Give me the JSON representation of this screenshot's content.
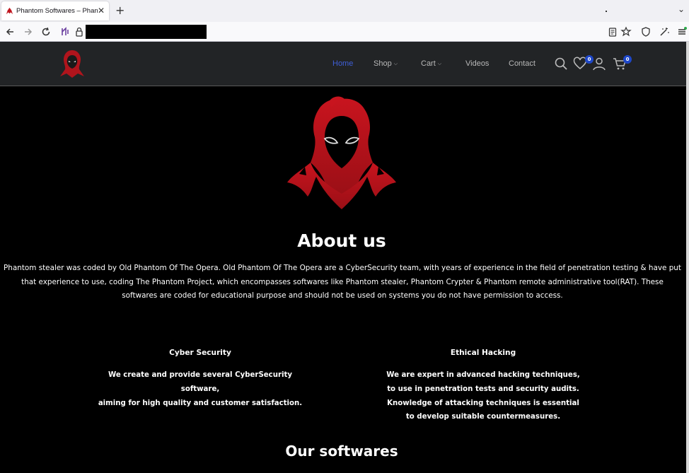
{
  "browser": {
    "tab_title": "Phantom Softwares – Phantom",
    "tab_close": "✕",
    "new_tab": "+",
    "tabs_menu": "⌄"
  },
  "header": {
    "menu": [
      {
        "label": "Home",
        "active": true
      },
      {
        "label": "Shop",
        "dropdown": true
      },
      {
        "label": "Cart",
        "dropdown": true
      },
      {
        "label": "Videos"
      },
      {
        "label": "Contact"
      }
    ],
    "caret": "⌵",
    "wishlist_count": "0",
    "cart_count": "0",
    "accent_color": "#3f5fd7",
    "brand_red": "#c0161f"
  },
  "about": {
    "title": "About us",
    "text": "Phantom stealer was coded by Old Phantom Of The Opera. Old Phantom Of The Opera are a CyberSecurity team, with years of experience in the field of penetration testing & have put that experience to use, coding  The Phantom Project, which encompasses softwares like Phantom stealer, Phantom Crypter & Phantom remote administrative tool(RAT). These softwares are coded for educational purpose and should not be used on systems you do not have permission to access."
  },
  "features": [
    {
      "title": "Cyber Security",
      "lines": [
        "We create and provide several CyberSecurity software,",
        "aiming for high quality and customer satisfaction."
      ]
    },
    {
      "title": "Ethical Hacking",
      "lines": [
        "We are expert in advanced hacking techniques,",
        "to use in penetration tests and security audits.",
        "Knowledge of attacking techniques is essential",
        "to develop suitable countermeasures."
      ]
    }
  ],
  "softwares_title": "Our softwares"
}
